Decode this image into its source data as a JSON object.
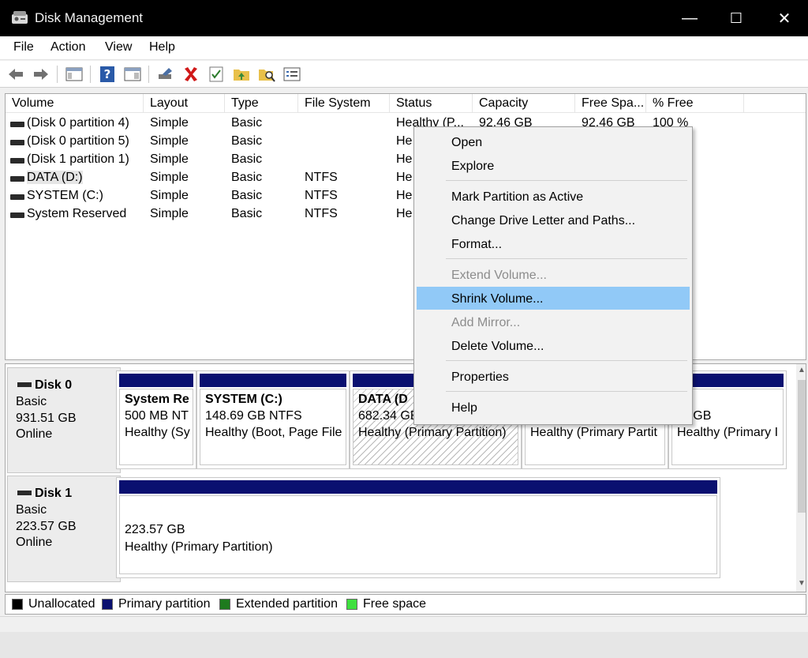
{
  "window": {
    "title": "Disk Management",
    "minimize": "—",
    "maximize": "☐",
    "close": "✕"
  },
  "menu": [
    "File",
    "Action",
    "View",
    "Help"
  ],
  "toolbar_icons": [
    "back-arrow-icon",
    "forward-arrow-icon",
    "console-tree-icon",
    "help-icon",
    "properties-pane-icon",
    "connect-drive-icon",
    "delete-icon",
    "check-icon",
    "folder-up-icon",
    "search-folder-icon",
    "list-icon"
  ],
  "columns": [
    "Volume",
    "Layout",
    "Type",
    "File System",
    "Status",
    "Capacity",
    "Free Spa...",
    "% Free"
  ],
  "volumes": [
    {
      "name": "(Disk 0 partition 4)",
      "layout": "Simple",
      "type": "Basic",
      "fs": "",
      "status": "Healthy (P...",
      "capacity": "92.46 GB",
      "free": "92.46 GB",
      "pct": "100 %"
    },
    {
      "name": "(Disk 0 partition 5)",
      "layout": "Simple",
      "type": "Basic",
      "fs": "",
      "status": "He"
    },
    {
      "name": "(Disk 1 partition 1)",
      "layout": "Simple",
      "type": "Basic",
      "fs": "",
      "status": "He"
    },
    {
      "name": "DATA (D:)",
      "layout": "Simple",
      "type": "Basic",
      "fs": "NTFS",
      "status": "He"
    },
    {
      "name": "SYSTEM (C:)",
      "layout": "Simple",
      "type": "Basic",
      "fs": "NTFS",
      "status": "He"
    },
    {
      "name": "System Reserved",
      "layout": "Simple",
      "type": "Basic",
      "fs": "NTFS",
      "status": "He"
    }
  ],
  "disks": [
    {
      "name": "Disk 0",
      "kind": "Basic",
      "size": "931.51 GB",
      "state": "Online",
      "partitions": [
        {
          "line1": "System Re",
          "line2": "500 MB NT",
          "line3": "Healthy (Sy"
        },
        {
          "line1": "SYSTEM  (C:)",
          "line2": "148.69 GB NTFS",
          "line3": "Healthy (Boot, Page File"
        },
        {
          "line1": "DATA  (D",
          "line2": "682.34 GB",
          "line3": "Healthy (Primary Partition)"
        },
        {
          "line1": "",
          "line2": "",
          "line3": "Healthy (Primary Partit"
        },
        {
          "line1": "",
          "line2": "54 GB",
          "line3": "Healthy (Primary I"
        }
      ]
    },
    {
      "name": "Disk 1",
      "kind": "Basic",
      "size": "223.57 GB",
      "state": "Online",
      "partitions": [
        {
          "line1": "",
          "line2": "223.57 GB",
          "line3": "Healthy (Primary Partition)"
        }
      ]
    }
  ],
  "legend": [
    {
      "label": "Unallocated",
      "color": "#000000"
    },
    {
      "label": "Primary partition",
      "color": "#0a1070"
    },
    {
      "label": "Extended partition",
      "color": "#1e7a1e"
    },
    {
      "label": "Free space",
      "color": "#3fe03f"
    }
  ],
  "context_menu": {
    "open": "Open",
    "explore": "Explore",
    "mark_active": "Mark Partition as Active",
    "change_letter": "Change Drive Letter and Paths...",
    "format": "Format...",
    "extend": "Extend Volume...",
    "shrink": "Shrink Volume...",
    "add_mirror": "Add Mirror...",
    "delete": "Delete Volume...",
    "properties": "Properties",
    "help": "Help"
  },
  "scroll_arrows": {
    "up": "▲",
    "down": "▼"
  },
  "colors": {
    "primary_partition": "#0a1070",
    "menu_highlight": "#91c9f7",
    "titlebar": "#000000"
  }
}
